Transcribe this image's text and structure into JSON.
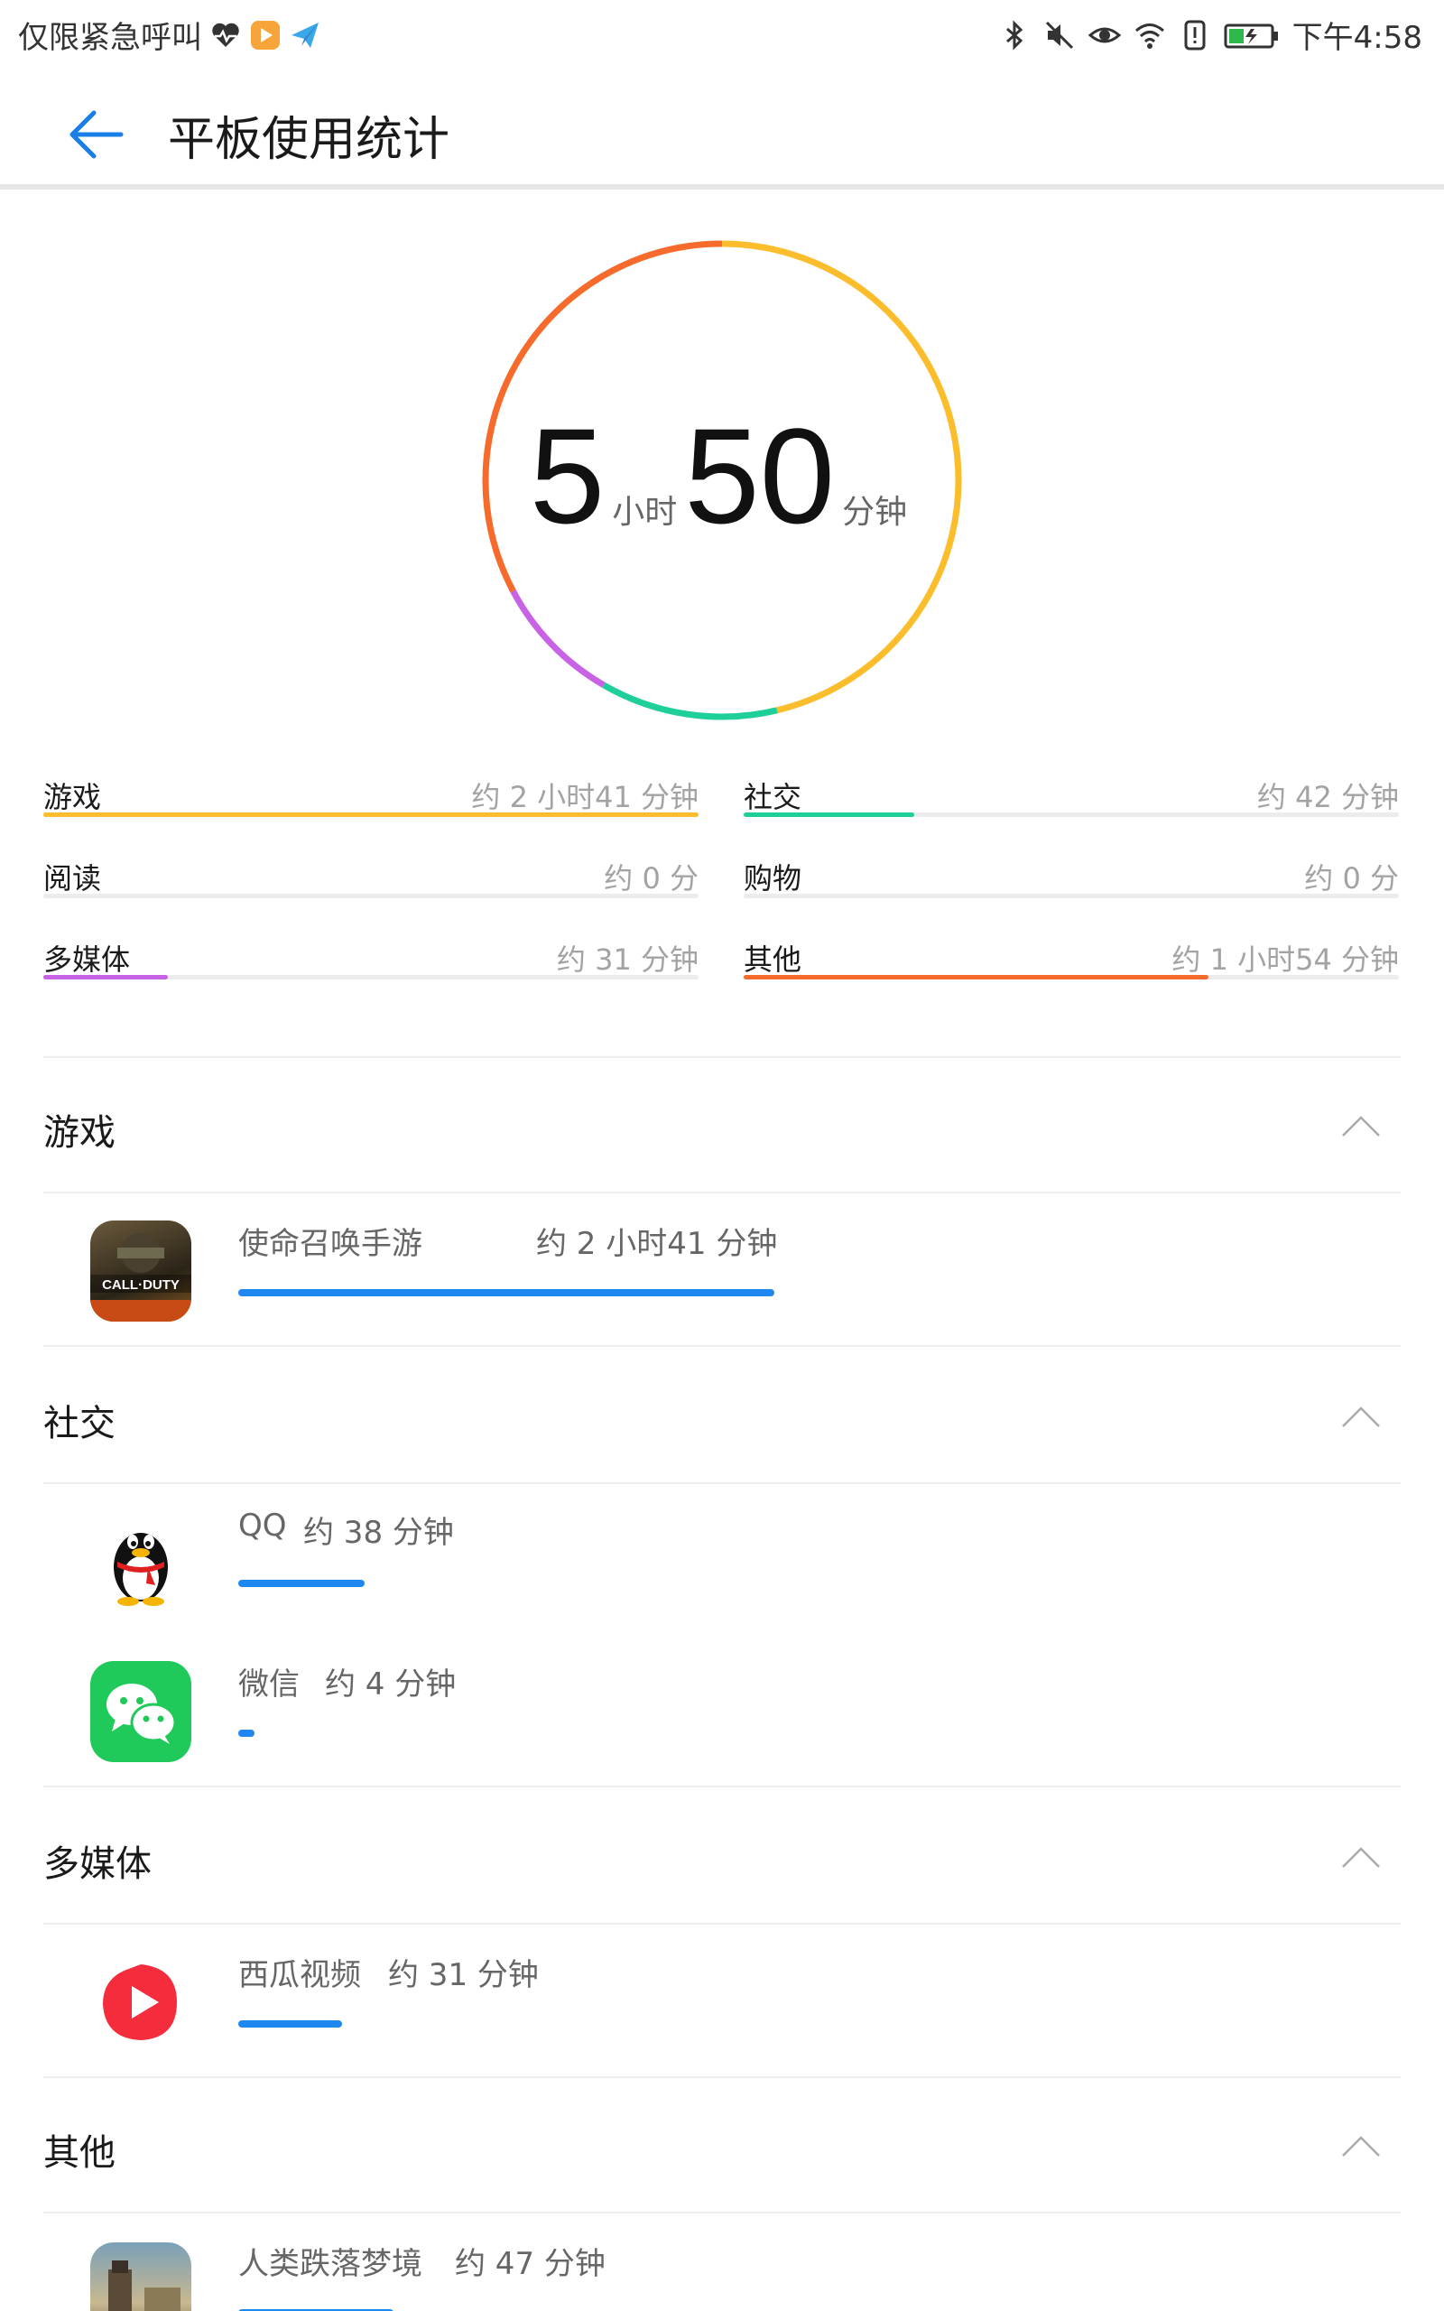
{
  "status_bar": {
    "left_text": "仅限紧急呼叫",
    "time": "下午4:58",
    "icons": [
      "heartbeat-icon",
      "video-app-icon",
      "paper-plane-icon",
      "bluetooth-icon",
      "mute-icon",
      "eye-icon",
      "wifi-icon",
      "alert-icon",
      "battery-icon"
    ]
  },
  "header": {
    "title": "平板使用统计"
  },
  "total": {
    "hours": "5",
    "hours_unit": "小时",
    "minutes": "50",
    "minutes_unit": "分钟"
  },
  "ring_segments": [
    {
      "name": "游戏",
      "minutes": 161,
      "color": "#fbbd2b"
    },
    {
      "name": "社交",
      "minutes": 42,
      "color": "#1fcf9a"
    },
    {
      "name": "多媒体",
      "minutes": 31,
      "color": "#c963e6"
    },
    {
      "name": "其他",
      "minutes": 114,
      "color": "#f66a2c"
    }
  ],
  "categories": [
    {
      "name": "游戏",
      "value": "约 2 小时41 分钟",
      "fraction": 1.0,
      "color": "#fbbd2b"
    },
    {
      "name": "社交",
      "value": "约 42 分钟",
      "fraction": 0.26,
      "color": "#1fcf9a"
    },
    {
      "name": "阅读",
      "value": "约 0 分",
      "fraction": 0.0,
      "color": "#fbbd2b"
    },
    {
      "name": "购物",
      "value": "约 0 分",
      "fraction": 0.0,
      "color": "#fbbd2b"
    },
    {
      "name": "多媒体",
      "value": "约 31 分钟",
      "fraction": 0.19,
      "color": "#c963e6"
    },
    {
      "name": "其他",
      "value": "约 1 小时54 分钟",
      "fraction": 0.71,
      "color": "#f66a2c"
    }
  ],
  "sections": [
    {
      "title": "游戏",
      "apps": [
        {
          "name": "使命召唤手游",
          "time": "约 2 小时41 分钟",
          "fraction": 1.0,
          "icon": "call-of-duty-icon",
          "icon_text": "CALL·DUTY"
        }
      ]
    },
    {
      "title": "社交",
      "apps": [
        {
          "name": "QQ",
          "time": "约 38 分钟",
          "fraction": 0.236,
          "icon": "qq-penguin-icon"
        },
        {
          "name": "微信",
          "time": "约 4 分钟",
          "fraction": 0.03,
          "icon": "wechat-icon"
        }
      ]
    },
    {
      "title": "多媒体",
      "apps": [
        {
          "name": "西瓜视频",
          "time": "约 31 分钟",
          "fraction": 0.193,
          "icon": "xigua-video-icon"
        }
      ]
    },
    {
      "title": "其他",
      "apps": [
        {
          "name": "人类跌落梦境",
          "time": "约 47 分钟",
          "fraction": 0.29,
          "icon": "human-fall-flat-icon"
        }
      ]
    }
  ],
  "colors": {
    "accent_blue": "#1e88f0",
    "back_arrow": "#1a7ee8"
  }
}
